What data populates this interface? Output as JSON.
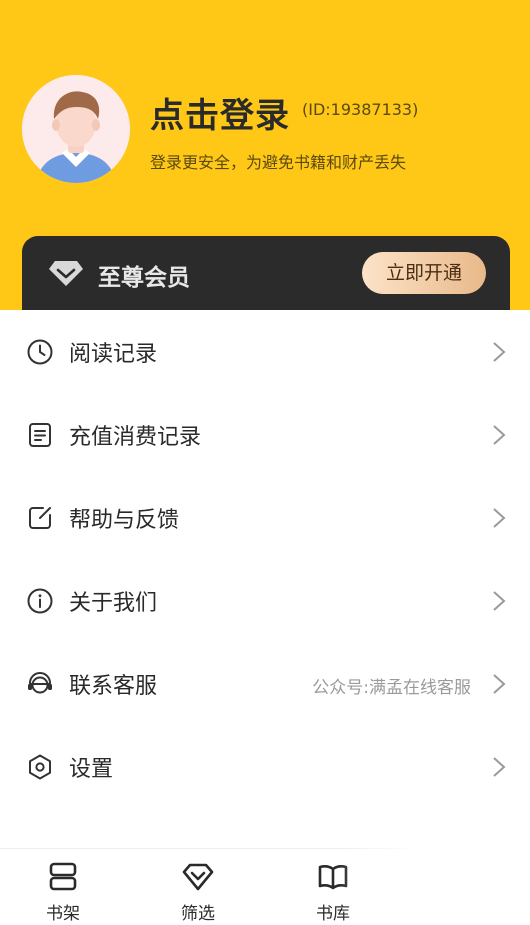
{
  "colors": {
    "header": "#FFC817",
    "vip_card": "#2B2B2B",
    "vip_button_start": "#FCE3C8",
    "vip_button_end": "#E8B98A"
  },
  "profile": {
    "title": "点击登录",
    "id": "(ID:19387133)",
    "subtitle": "登录更安全，为避免书籍和财产丢失",
    "avatar_icon": "default-user-avatar"
  },
  "vip": {
    "icon": "diamond-icon",
    "label": "至尊会员",
    "button": "立即开通"
  },
  "menu": {
    "items": [
      {
        "icon": "clock-icon",
        "label": "阅读记录",
        "note": ""
      },
      {
        "icon": "receipt-icon",
        "label": "充值消费记录",
        "note": ""
      },
      {
        "icon": "edit-icon",
        "label": "帮助与反馈",
        "note": ""
      },
      {
        "icon": "info-icon",
        "label": "关于我们",
        "note": ""
      },
      {
        "icon": "headset-icon",
        "label": "联系客服",
        "note": "公众号:满孟在线客服"
      },
      {
        "icon": "settings-icon",
        "label": "设置",
        "note": ""
      }
    ]
  },
  "tabbar": {
    "items": [
      {
        "icon": "bookshelf-icon",
        "label": "书架"
      },
      {
        "icon": "filter-diamond-icon",
        "label": "筛选"
      },
      {
        "icon": "book-open-icon",
        "label": "书库"
      }
    ]
  }
}
